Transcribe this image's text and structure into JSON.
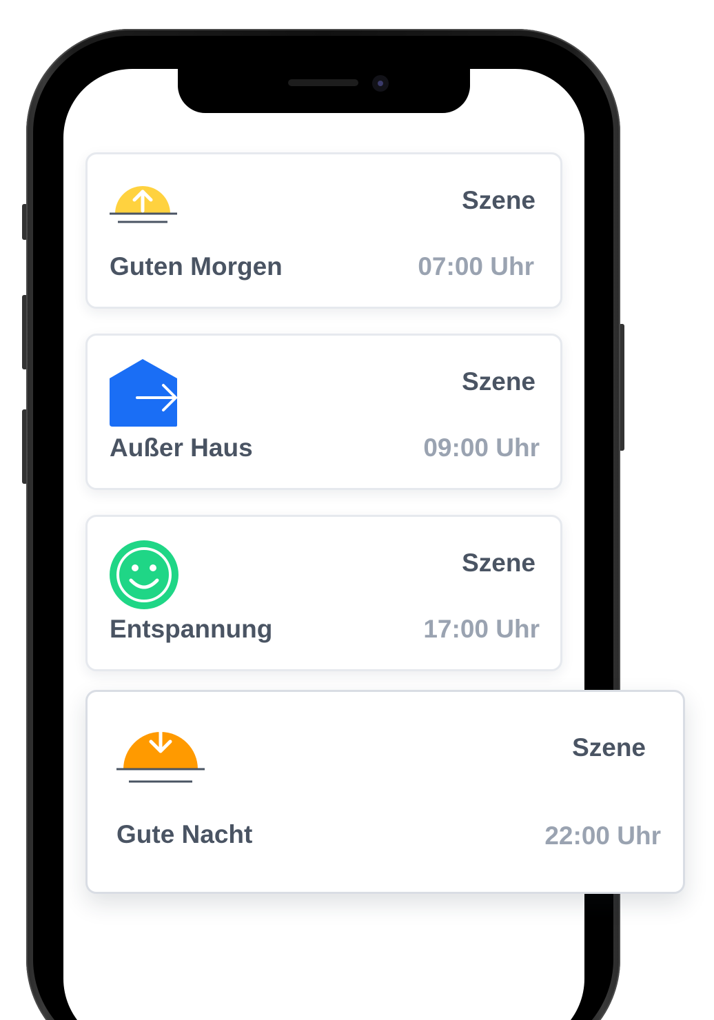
{
  "scenes": [
    {
      "kind": "Szene",
      "name": "Guten Morgen",
      "time": "07:00 Uhr",
      "icon": "sunrise-icon",
      "color": "#ffd23f"
    },
    {
      "kind": "Szene",
      "name": "Außer Haus",
      "time": "09:00 Uhr",
      "icon": "leave-home-icon",
      "color": "#1a6ef5"
    },
    {
      "kind": "Szene",
      "name": "Entspannung",
      "time": "17:00 Uhr",
      "icon": "smiley-icon",
      "color": "#1fd686"
    },
    {
      "kind": "Szene",
      "name": "Gute Nacht",
      "time": "22:00 Uhr",
      "icon": "sunset-icon",
      "color": "#ff9a00"
    }
  ],
  "colors": {
    "text_primary": "#4a5463",
    "text_secondary": "#9aa3b1",
    "card_border": "#e6e9ee"
  }
}
